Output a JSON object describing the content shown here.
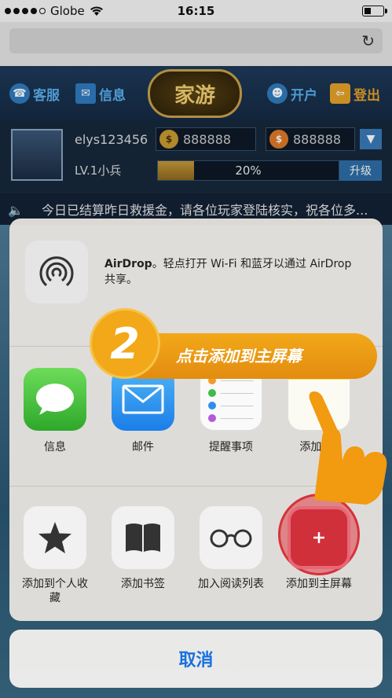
{
  "status_bar": {
    "carrier": "Globe",
    "time": "16:15"
  },
  "game": {
    "header": {
      "service": "客服",
      "messages": "信息",
      "logo": "家游",
      "open_account": "开户",
      "logout": "登出"
    },
    "user": {
      "username": "elys123456",
      "gold": "888888",
      "coins": "888888",
      "level": "LV.1小兵",
      "progress_text": "20%",
      "progress": 0.2,
      "upgrade": "升级"
    },
    "notice": "今日已结算昨日救援金，请各位玩家登陆核实，祝各位多..."
  },
  "share_sheet": {
    "airdrop_title": "AirDrop",
    "airdrop_desc": "。轻点打开 Wi-Fi 和蓝牙以通过 AirDrop 共享。",
    "apps": [
      {
        "label": "信息",
        "icon": "messages-icon"
      },
      {
        "label": "邮件",
        "icon": "mail-icon"
      },
      {
        "label": "提醒事项",
        "icon": "reminders-icon"
      },
      {
        "label": "添加到“",
        "icon": "notes-icon"
      }
    ],
    "actions": [
      {
        "label": "添加到个人收藏",
        "icon": "star-icon"
      },
      {
        "label": "添加书签",
        "icon": "book-icon"
      },
      {
        "label": "加入阅读列表",
        "icon": "glasses-icon"
      },
      {
        "label": "添加到主屏幕",
        "icon": "add-icon"
      }
    ],
    "cancel": "取消"
  },
  "tutorial": {
    "step": "2",
    "text": "点击添加到主屏幕"
  },
  "colors": {
    "accent": "#f2a818",
    "ios_blue": "#1a6fe0",
    "highlight": "#d8303a"
  }
}
